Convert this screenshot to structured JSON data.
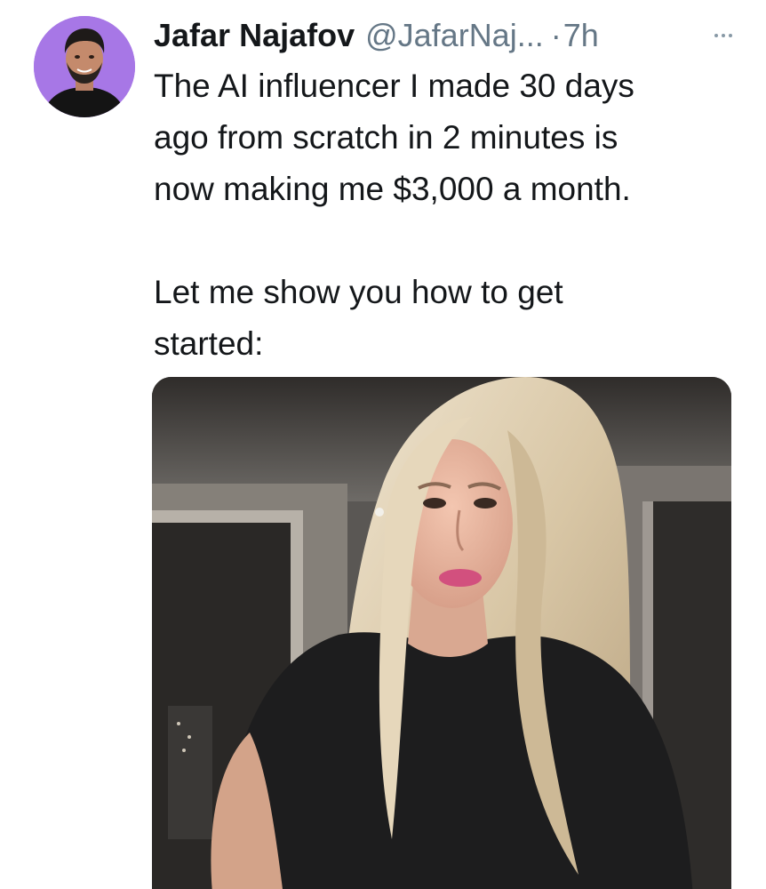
{
  "tweet": {
    "author": {
      "display_name": "Jafar Najafov",
      "handle": "@JafarNaj...",
      "avatar_icon": "profile-photo",
      "avatar_bg": "#a777e6"
    },
    "separator": "·",
    "timestamp": "7h",
    "more_icon": "ellipsis-icon",
    "text_paragraphs": [
      "The AI influencer I made 30 days\nago from scratch in 2 minutes is\nnow making me $3,000 a month.",
      "Let me show you how to get\nstarted:"
    ],
    "media": {
      "type": "photo"
    }
  },
  "colors": {
    "primary_text": "#14171a",
    "secondary_text": "#657786",
    "background": "#ffffff"
  }
}
